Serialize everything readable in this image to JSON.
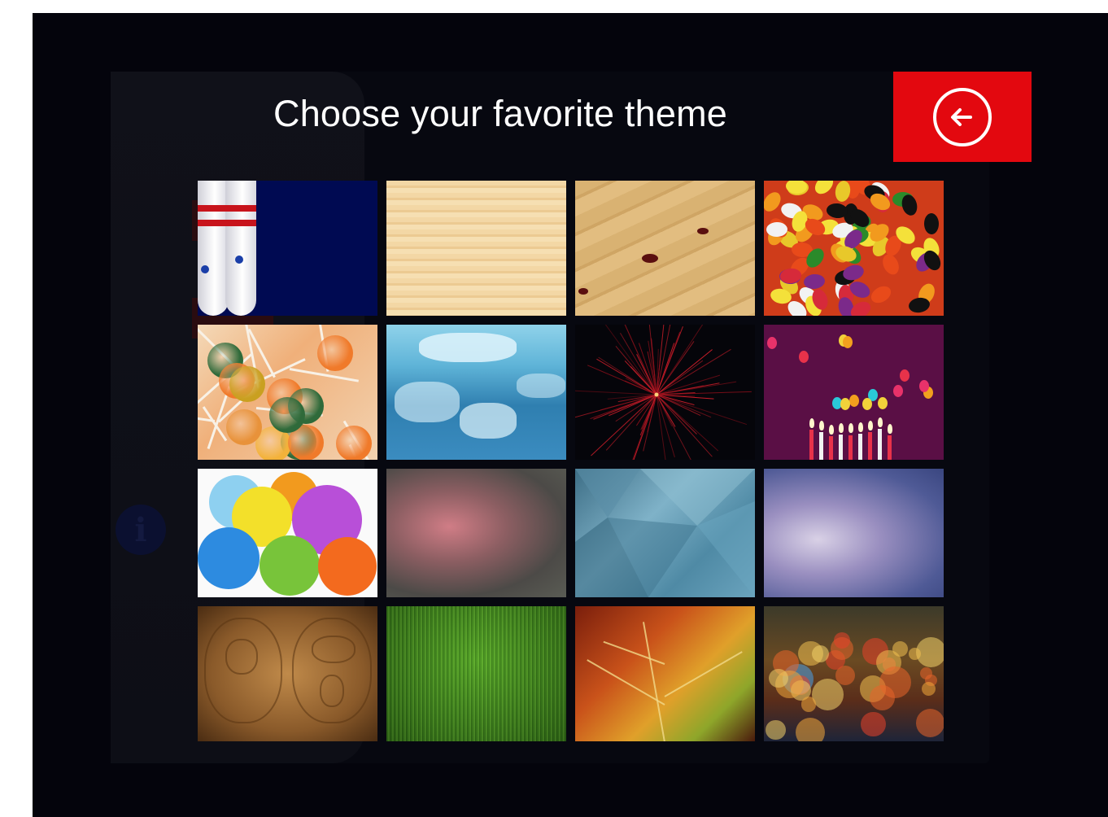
{
  "page": {
    "title": "Choose your favorite theme"
  },
  "back_button": {
    "icon": "arrow-left-circle-icon",
    "background_color": "#e3080f"
  },
  "themes": [
    {
      "name": "bowling-pins"
    },
    {
      "name": "light-wood"
    },
    {
      "name": "bowling-lane-wood"
    },
    {
      "name": "jelly-beans"
    },
    {
      "name": "lollipops"
    },
    {
      "name": "water-reflection"
    },
    {
      "name": "fireworks"
    },
    {
      "name": "birthday-party"
    },
    {
      "name": "balloons"
    },
    {
      "name": "pink-blur"
    },
    {
      "name": "polygon-blue"
    },
    {
      "name": "purple-blur"
    },
    {
      "name": "old-world-map"
    },
    {
      "name": "grass"
    },
    {
      "name": "autumn-leaf"
    },
    {
      "name": "bokeh-lights"
    }
  ]
}
